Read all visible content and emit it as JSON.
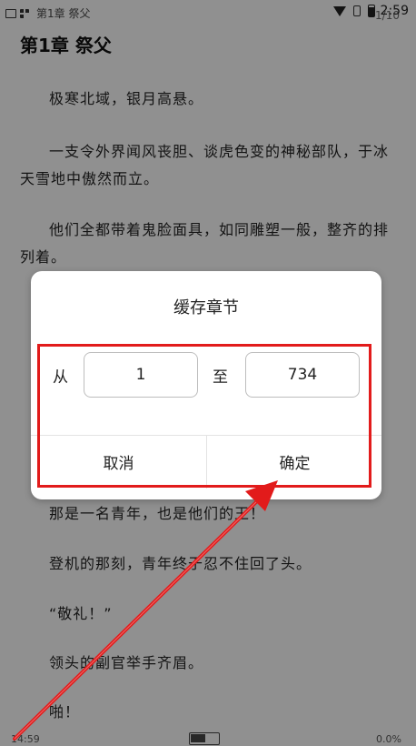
{
  "statusbar": {
    "book_title": "第1章 祭父",
    "time": "2:59",
    "page_indicator": "1/10"
  },
  "reader": {
    "chapter_title": "第1章 祭父",
    "paragraphs": [
      "极寒北域，银月高悬。",
      "一支令外界闻风丧胆、谈虎色变的神秘部队，于冰天雪地中傲然而立。",
      "他们全都带着鬼脸面具，如同雕塑一般，整齐的排列着。",
      "那是一名青年，也是他们的王！",
      "登机的那刻，青年终于忍不住回了头。",
      "“敬礼！”",
      "领头的副官举手齐眉。",
      "啪！"
    ],
    "footer_time": "14:59",
    "footer_percent": "0.0%"
  },
  "dialog": {
    "title": "缓存章节",
    "from_label": "从",
    "from_value": "1",
    "to_label": "至",
    "to_value": "734",
    "cancel_label": "取消",
    "confirm_label": "确定"
  },
  "colors": {
    "annotation": "#e21b1b",
    "overlay": "rgba(0,0,0,0.40)"
  }
}
